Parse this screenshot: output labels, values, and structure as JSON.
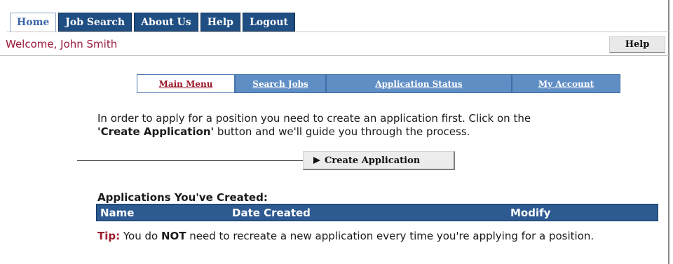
{
  "top_tabs": [
    {
      "label": "Home",
      "active": true
    },
    {
      "label": "Job Search",
      "active": false
    },
    {
      "label": "About Us",
      "active": false
    },
    {
      "label": "Help",
      "active": false
    },
    {
      "label": "Logout",
      "active": false
    }
  ],
  "welcome": {
    "prefix": "Welcome, ",
    "user": "John Smith"
  },
  "help_button": "Help",
  "sub_nav": [
    {
      "label": "Main Menu",
      "active": true
    },
    {
      "label": "Search Jobs",
      "active": false
    },
    {
      "label": "Application Status",
      "active": false
    },
    {
      "label": "My Account",
      "active": false
    }
  ],
  "instruction": {
    "part1": "In order to apply for a position you need to create an application first. Click on the",
    "quote_open": "'",
    "bold": "Create Application",
    "quote_close": "'",
    "part2": " button and we'll guide you through the process."
  },
  "create_button": "Create Application",
  "applications": {
    "title": "Applications You've Created:",
    "columns": [
      "Name",
      "Date Created",
      "Modify"
    ]
  },
  "tip": {
    "label": "Tip:",
    "part1": " You do ",
    "bold": "NOT",
    "part2": " need to recreate a new application every time you're applying for a position."
  },
  "colors": {
    "tab_blue": "#1f4e82",
    "subnav_blue": "#5f8ec4",
    "header_blue": "#2d5b91",
    "accent_red": "#9b1a2a"
  }
}
